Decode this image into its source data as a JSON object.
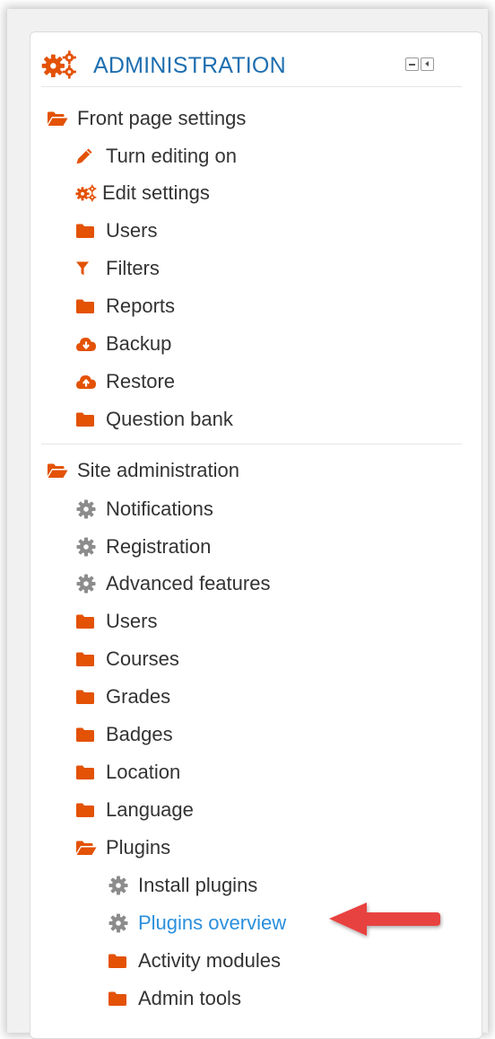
{
  "block": {
    "title": "ADMINISTRATION",
    "title_icon": "gears-icon",
    "minimize_icon": "minimize-icon",
    "dock_icon": "dock-icon"
  },
  "colors": {
    "accent_orange": "#e35205",
    "title_blue": "#1f6fb0",
    "link_active": "#2a8fdd",
    "gear_grey": "#8c8c8c",
    "arrow_red": "#e8423f"
  },
  "front_page": {
    "label": "Front page settings",
    "icon": "folder-open-icon",
    "items": [
      {
        "label": "Turn editing on",
        "icon": "pencil-icon"
      },
      {
        "label": "Edit settings",
        "icon": "gears-icon"
      },
      {
        "label": "Users",
        "icon": "folder-icon"
      },
      {
        "label": "Filters",
        "icon": "filter-icon"
      },
      {
        "label": "Reports",
        "icon": "folder-icon"
      },
      {
        "label": "Backup",
        "icon": "cloud-download-icon"
      },
      {
        "label": "Restore",
        "icon": "cloud-upload-icon"
      },
      {
        "label": "Question bank",
        "icon": "folder-icon"
      }
    ]
  },
  "site_admin": {
    "label": "Site administration",
    "icon": "folder-open-icon",
    "items": [
      {
        "label": "Notifications",
        "icon": "gear-icon"
      },
      {
        "label": "Registration",
        "icon": "gear-icon"
      },
      {
        "label": "Advanced features",
        "icon": "gear-icon"
      },
      {
        "label": "Users",
        "icon": "folder-icon"
      },
      {
        "label": "Courses",
        "icon": "folder-icon"
      },
      {
        "label": "Grades",
        "icon": "folder-icon"
      },
      {
        "label": "Badges",
        "icon": "folder-icon"
      },
      {
        "label": "Location",
        "icon": "folder-icon"
      },
      {
        "label": "Language",
        "icon": "folder-icon"
      }
    ],
    "plugins": {
      "label": "Plugins",
      "icon": "folder-open-icon",
      "items": [
        {
          "label": "Install plugins",
          "icon": "gear-icon"
        },
        {
          "label": "Plugins overview",
          "icon": "gear-icon",
          "active": true
        },
        {
          "label": "Activity modules",
          "icon": "folder-icon"
        },
        {
          "label": "Admin tools",
          "icon": "folder-icon"
        }
      ]
    }
  },
  "annotation": {
    "icon": "red-arrow-icon"
  }
}
